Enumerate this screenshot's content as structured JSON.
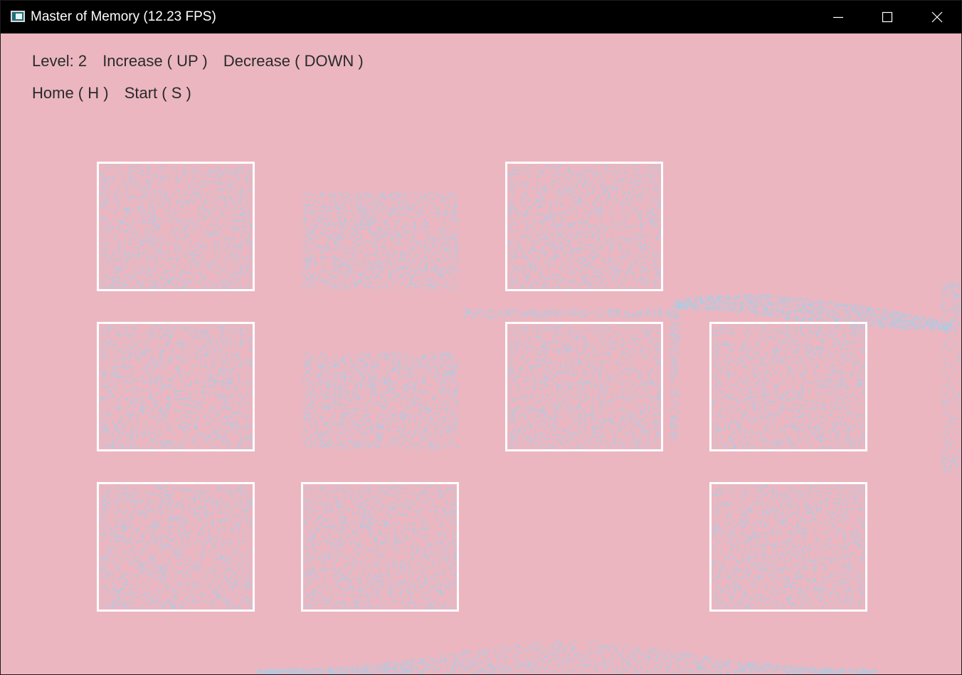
{
  "window": {
    "title": "Master of Memory (12.23 FPS)",
    "app_icon": "app-window-icon",
    "controls": [
      "minimize-icon",
      "maximize-icon",
      "close-icon"
    ]
  },
  "hud": {
    "level": "Level: 2",
    "increase": "Increase ( UP )",
    "decrease": "Decrease ( DOWN )",
    "home": "Home ( H )",
    "start": "Start ( S )"
  },
  "colors": {
    "background": "#ebb6c0",
    "particle": "#a9cde6",
    "card_border": "#ffffff",
    "hud_text": "#2a2a2a",
    "titlebar": "#000000"
  },
  "board": {
    "rows": 3,
    "columns": 4,
    "cells": [
      {
        "row": 1,
        "col": 1,
        "state": "framed"
      },
      {
        "row": 1,
        "col": 2,
        "state": "dissolving"
      },
      {
        "row": 1,
        "col": 3,
        "state": "framed"
      },
      {
        "row": 1,
        "col": 4,
        "state": "empty"
      },
      {
        "row": 2,
        "col": 1,
        "state": "framed"
      },
      {
        "row": 2,
        "col": 2,
        "state": "dissolving"
      },
      {
        "row": 2,
        "col": 3,
        "state": "framed"
      },
      {
        "row": 2,
        "col": 4,
        "state": "framed"
      },
      {
        "row": 3,
        "col": 1,
        "state": "framed"
      },
      {
        "row": 3,
        "col": 2,
        "state": "framed"
      },
      {
        "row": 3,
        "col": 3,
        "state": "empty"
      },
      {
        "row": 3,
        "col": 4,
        "state": "framed"
      }
    ]
  }
}
